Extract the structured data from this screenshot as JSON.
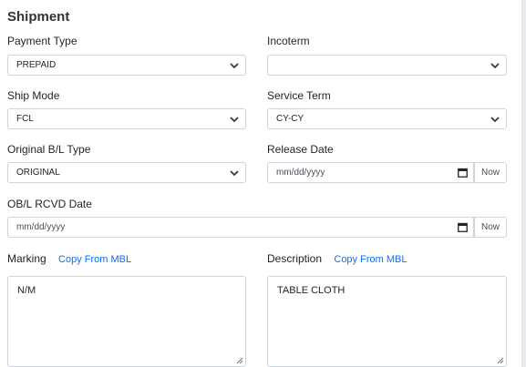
{
  "section": {
    "title": "Shipment"
  },
  "fields": {
    "payment_type": {
      "label": "Payment Type",
      "value": "PREPAID"
    },
    "incoterm": {
      "label": "Incoterm",
      "value": ""
    },
    "ship_mode": {
      "label": "Ship Mode",
      "value": "FCL"
    },
    "service_term": {
      "label": "Service Term",
      "value": "CY-CY"
    },
    "original_bl_type": {
      "label": "Original B/L Type",
      "value": "ORIGINAL"
    },
    "release_date": {
      "label": "Release Date",
      "placeholder": "mm/dd/yyyy",
      "now_label": "Now"
    },
    "obl_rcvd_date": {
      "label": "OB/L RCVD Date",
      "placeholder": "mm/dd/yyyy",
      "now_label": "Now"
    },
    "marking": {
      "label": "Marking",
      "copy_link": "Copy From MBL",
      "value": "N/M"
    },
    "description": {
      "label": "Description",
      "copy_link": "Copy From MBL",
      "value": "TABLE CLOTH"
    }
  },
  "icons": {
    "dropdown": "chevron-down-icon",
    "calendar": "calendar-icon",
    "resize": "resize-grip-icon"
  },
  "colors": {
    "link": "#0d6efd",
    "border": "#ced4da",
    "text": "#212529"
  }
}
